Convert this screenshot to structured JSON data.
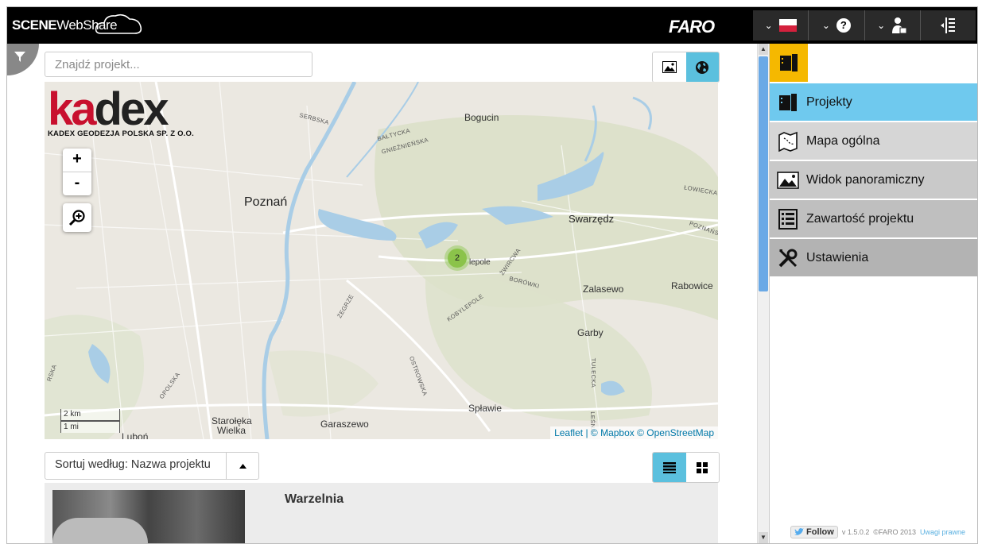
{
  "app": {
    "brand_scene": "SCENE",
    "brand_webshare": "WebShare",
    "vendor_logo": "FARO"
  },
  "search": {
    "placeholder": "Znajdź projekt..."
  },
  "map": {
    "logo_word_prefix": "ka",
    "logo_word_suffix": "dex",
    "logo_subtitle": "KADEX GEODEZJA POLSKA SP. Z O.O.",
    "zoom_in": "+",
    "zoom_out": "-",
    "places": {
      "poznan": "Poznań",
      "swarzedz": "Swarzędz",
      "bogucin": "Bogucin",
      "zalasewo": "Zalasewo",
      "rabowice": "Rabowice",
      "garby": "Garby",
      "splawie": "Spławie",
      "starolęka": "Starołęka",
      "wielka": "Wielka",
      "garaszewo": "Garaszewo",
      "lubon": "Luboń",
      "kobylepole": "lepole"
    },
    "roads": {
      "serbska": "SERBSKA",
      "baltycka": "BAŁTYCKA",
      "gnieznienska": "GNIEŹNIEŃSKA",
      "lowiecka": "ŁOWIECKA",
      "poznanska": "POZNAŃS",
      "zwirowa": "ŻWIRCWA",
      "borowki": "BORÓWKI",
      "kobylepole": "KOBYLEPOLE",
      "zegrze": "ŻEGRZE",
      "opolska": "OPOLSKA",
      "ostrowska": "OSTROWSKA",
      "tulecka": "TULECKA",
      "lesna": "LEŚNA",
      "rska": "RSKA"
    },
    "cluster_count": "2",
    "scale_km": "2 km",
    "scale_mi": "1 mi",
    "attribution_leaflet": "Leaflet",
    "attribution_rest": "| © Mapbox © OpenStreetMap"
  },
  "sort": {
    "label": "Sortuj według: Nazwa projektu"
  },
  "projects": [
    {
      "title": "Warzelnia"
    }
  ],
  "menu": {
    "items": [
      {
        "label": "Projekty",
        "icon": "projects-icon"
      },
      {
        "label": "Mapa ogólna",
        "icon": "map-icon"
      },
      {
        "label": "Widok panoramiczny",
        "icon": "panorama-icon"
      },
      {
        "label": "Zawartość projektu",
        "icon": "content-list-icon"
      },
      {
        "label": "Ustawienia",
        "icon": "tools-icon"
      }
    ]
  },
  "footer": {
    "follow": "Follow",
    "version": "v 1.5.0.2",
    "copyright": "©FARO 2013",
    "legal": "Uwagi prawne"
  },
  "colors": {
    "accent": "#5bc0de",
    "menu_active": "#6fc9ee",
    "projects_tab": "#f5b800",
    "cluster": "#8bc34a"
  }
}
